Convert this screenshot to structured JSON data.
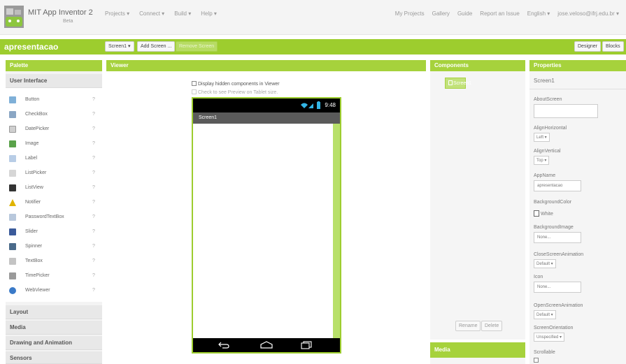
{
  "header": {
    "app_title": "MIT App Inventor 2",
    "app_subtitle": "Beta",
    "nav_left": [
      "Projects ▾",
      "Connect ▾",
      "Build ▾",
      "Help ▾"
    ],
    "nav_right": [
      "My Projects",
      "Gallery",
      "Guide",
      "Report an Issue",
      "English ▾",
      "jose.veloso@ifrj.edu.br ▾"
    ]
  },
  "project_bar": {
    "project_name": "apresentacao",
    "screen_select": "Screen1 ▾",
    "add_screen": "Add Screen ...",
    "remove_screen": "Remove Screen",
    "designer": "Designer",
    "blocks": "Blocks"
  },
  "palette": {
    "title": "Palette",
    "section_user_interface": "User Interface",
    "items": [
      {
        "label": "Button",
        "icon": "button-icon",
        "color": "#7fb0d8"
      },
      {
        "label": "CheckBox",
        "icon": "checkbox-icon",
        "color": "#8aa6c4"
      },
      {
        "label": "DatePicker",
        "icon": "datepicker-icon",
        "color": "#cfcfcf"
      },
      {
        "label": "Image",
        "icon": "image-icon",
        "color": "#5aa24a"
      },
      {
        "label": "Label",
        "icon": "label-icon",
        "color": "#b8cde6"
      },
      {
        "label": "ListPicker",
        "icon": "listpicker-icon",
        "color": "#d6d6d6"
      },
      {
        "label": "ListView",
        "icon": "listview-icon",
        "color": "#333333"
      },
      {
        "label": "Notifier",
        "icon": "notifier-icon",
        "color": "#e0b400"
      },
      {
        "label": "PasswordTextBox",
        "icon": "password-textbox-icon",
        "color": "#b8c8dc"
      },
      {
        "label": "Slider",
        "icon": "slider-icon",
        "color": "#3a5a9a"
      },
      {
        "label": "Spinner",
        "icon": "spinner-icon",
        "color": "#4a6a8a"
      },
      {
        "label": "TextBox",
        "icon": "textbox-icon",
        "color": "#c4c4c4"
      },
      {
        "label": "TimePicker",
        "icon": "timepicker-icon",
        "color": "#9a9a9a"
      },
      {
        "label": "WebViewer",
        "icon": "webviewer-icon",
        "color": "#3a7ac8"
      }
    ],
    "help_glyph": "?",
    "sections": [
      "Layout",
      "Media",
      "Drawing and Animation",
      "Sensors"
    ]
  },
  "viewer": {
    "title": "Viewer",
    "display_hidden": "Display hidden components in Viewer",
    "tablet_preview": "Check to see Preview on Tablet size.",
    "phone_time": "9:48",
    "screen_title": "Screen1"
  },
  "components": {
    "title": "Components",
    "root": "Screen1",
    "rename": "Rename",
    "delete": "Delete",
    "media_title": "Media"
  },
  "properties": {
    "title": "Properties",
    "screen_name": "Screen1",
    "about_screen": "AboutScreen",
    "align_horizontal": "AlignHorizontal",
    "align_horizontal_value": "Left ▾",
    "align_vertical": "AlignVertical",
    "align_vertical_value": "Top ▾",
    "app_name": "AppName",
    "app_name_value": "apresentacao",
    "background_color": "BackgroundColor",
    "background_color_value": "White",
    "background_image": "BackgroundImage",
    "background_image_value": "None...",
    "close_screen_animation": "CloseScreenAnimation",
    "close_screen_animation_value": "Default ▾",
    "icon": "Icon",
    "icon_value": "None...",
    "open_screen_animation": "OpenScreenAnimation",
    "open_screen_animation_value": "Default ▾",
    "screen_orientation": "ScreenOrientation",
    "screen_orientation_value": "Unspecified ▾",
    "scrollable": "Scrollable"
  },
  "colors": {
    "accent_green": "#9dcd2e",
    "header_bg": "#f4f4f4"
  }
}
